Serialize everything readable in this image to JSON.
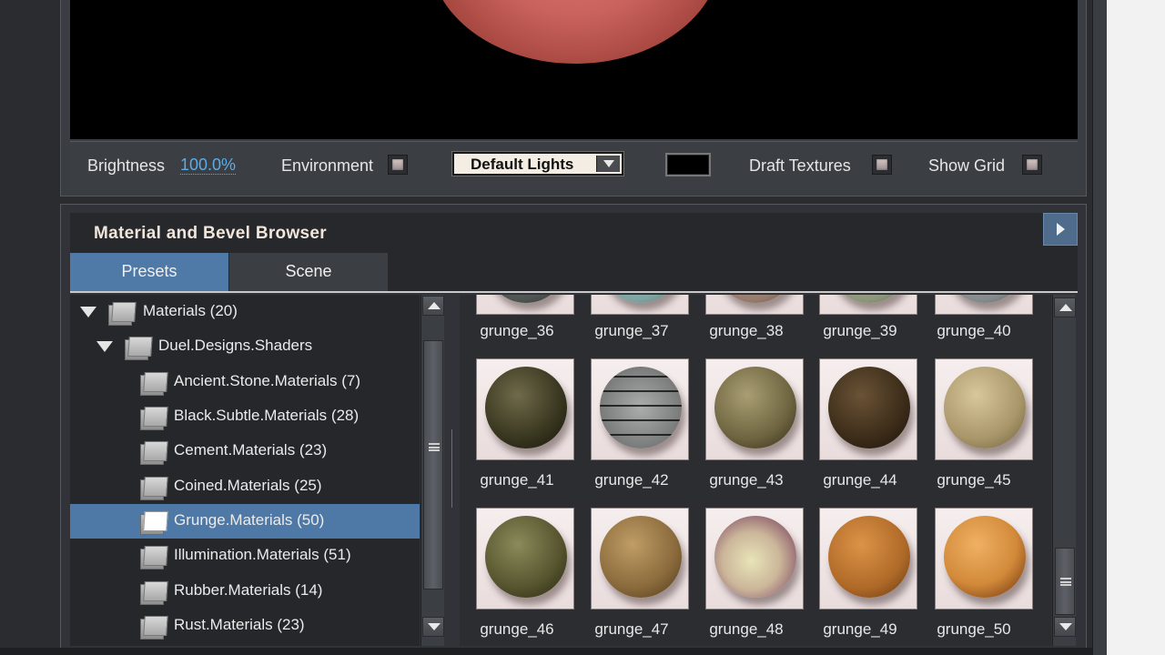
{
  "toolbar": {
    "brightness_label": "Brightness",
    "brightness_value": "100.0%",
    "environment_label": "Environment",
    "lights_selected": "Default Lights",
    "draft_textures_label": "Draft Textures",
    "show_grid_label": "Show Grid",
    "environment_checked": false,
    "draft_textures_checked": false,
    "show_grid_checked": false,
    "background_color": "#000000"
  },
  "browser": {
    "title": "Material and Bevel Browser",
    "tabs": [
      {
        "label": "Presets",
        "active": true
      },
      {
        "label": "Scene",
        "active": false
      }
    ]
  },
  "tree": {
    "items": [
      {
        "label": "Materials (20)",
        "expanded": true
      },
      {
        "label": "Duel.Designs.Shaders",
        "expanded": true
      },
      {
        "label": "Ancient.Stone.Materials (7)"
      },
      {
        "label": "Black.Subtle.Materials (28)"
      },
      {
        "label": "Cement.Materials (23)"
      },
      {
        "label": "Coined.Materials (25)"
      },
      {
        "label": "Grunge.Materials (50)",
        "selected": true
      },
      {
        "label": "Illumination.Materials (51)"
      },
      {
        "label": "Rubber.Materials (14)"
      },
      {
        "label": "Rust.Materials (23)"
      }
    ]
  },
  "grid": {
    "rows": [
      [
        "grunge_36",
        "grunge_37",
        "grunge_38",
        "grunge_39",
        "grunge_40"
      ],
      [
        "grunge_41",
        "grunge_42",
        "grunge_43",
        "grunge_44",
        "grunge_45"
      ],
      [
        "grunge_46",
        "grunge_47",
        "grunge_48",
        "grunge_49",
        "grunge_50"
      ]
    ]
  },
  "colors": {
    "accent": "#4f7aa8",
    "link": "#5aaee8",
    "panel": "#313338"
  }
}
